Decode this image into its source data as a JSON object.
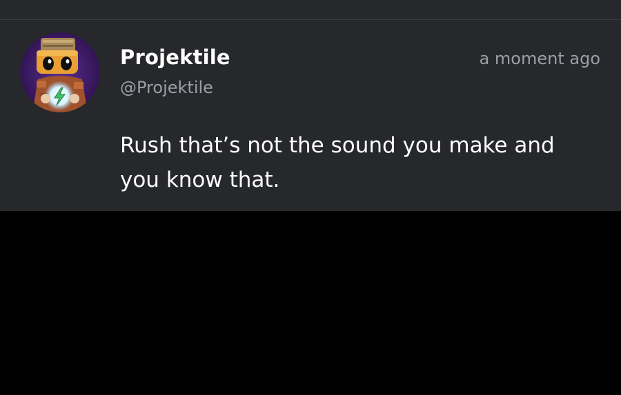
{
  "post": {
    "author_name": "Projektile",
    "author_handle": "@Projektile",
    "timestamp": "a moment ago",
    "body": "Rush that’s not the sound you make and you know that.",
    "avatar_icon": "robot-avatar-icon"
  },
  "colors": {
    "card_background": "#26282b",
    "page_background": "#000000",
    "primary_text": "#ffffff",
    "secondary_text": "#9aa0a6",
    "avatar_background": "#3b1d63",
    "accent_green": "#3cc46a"
  }
}
